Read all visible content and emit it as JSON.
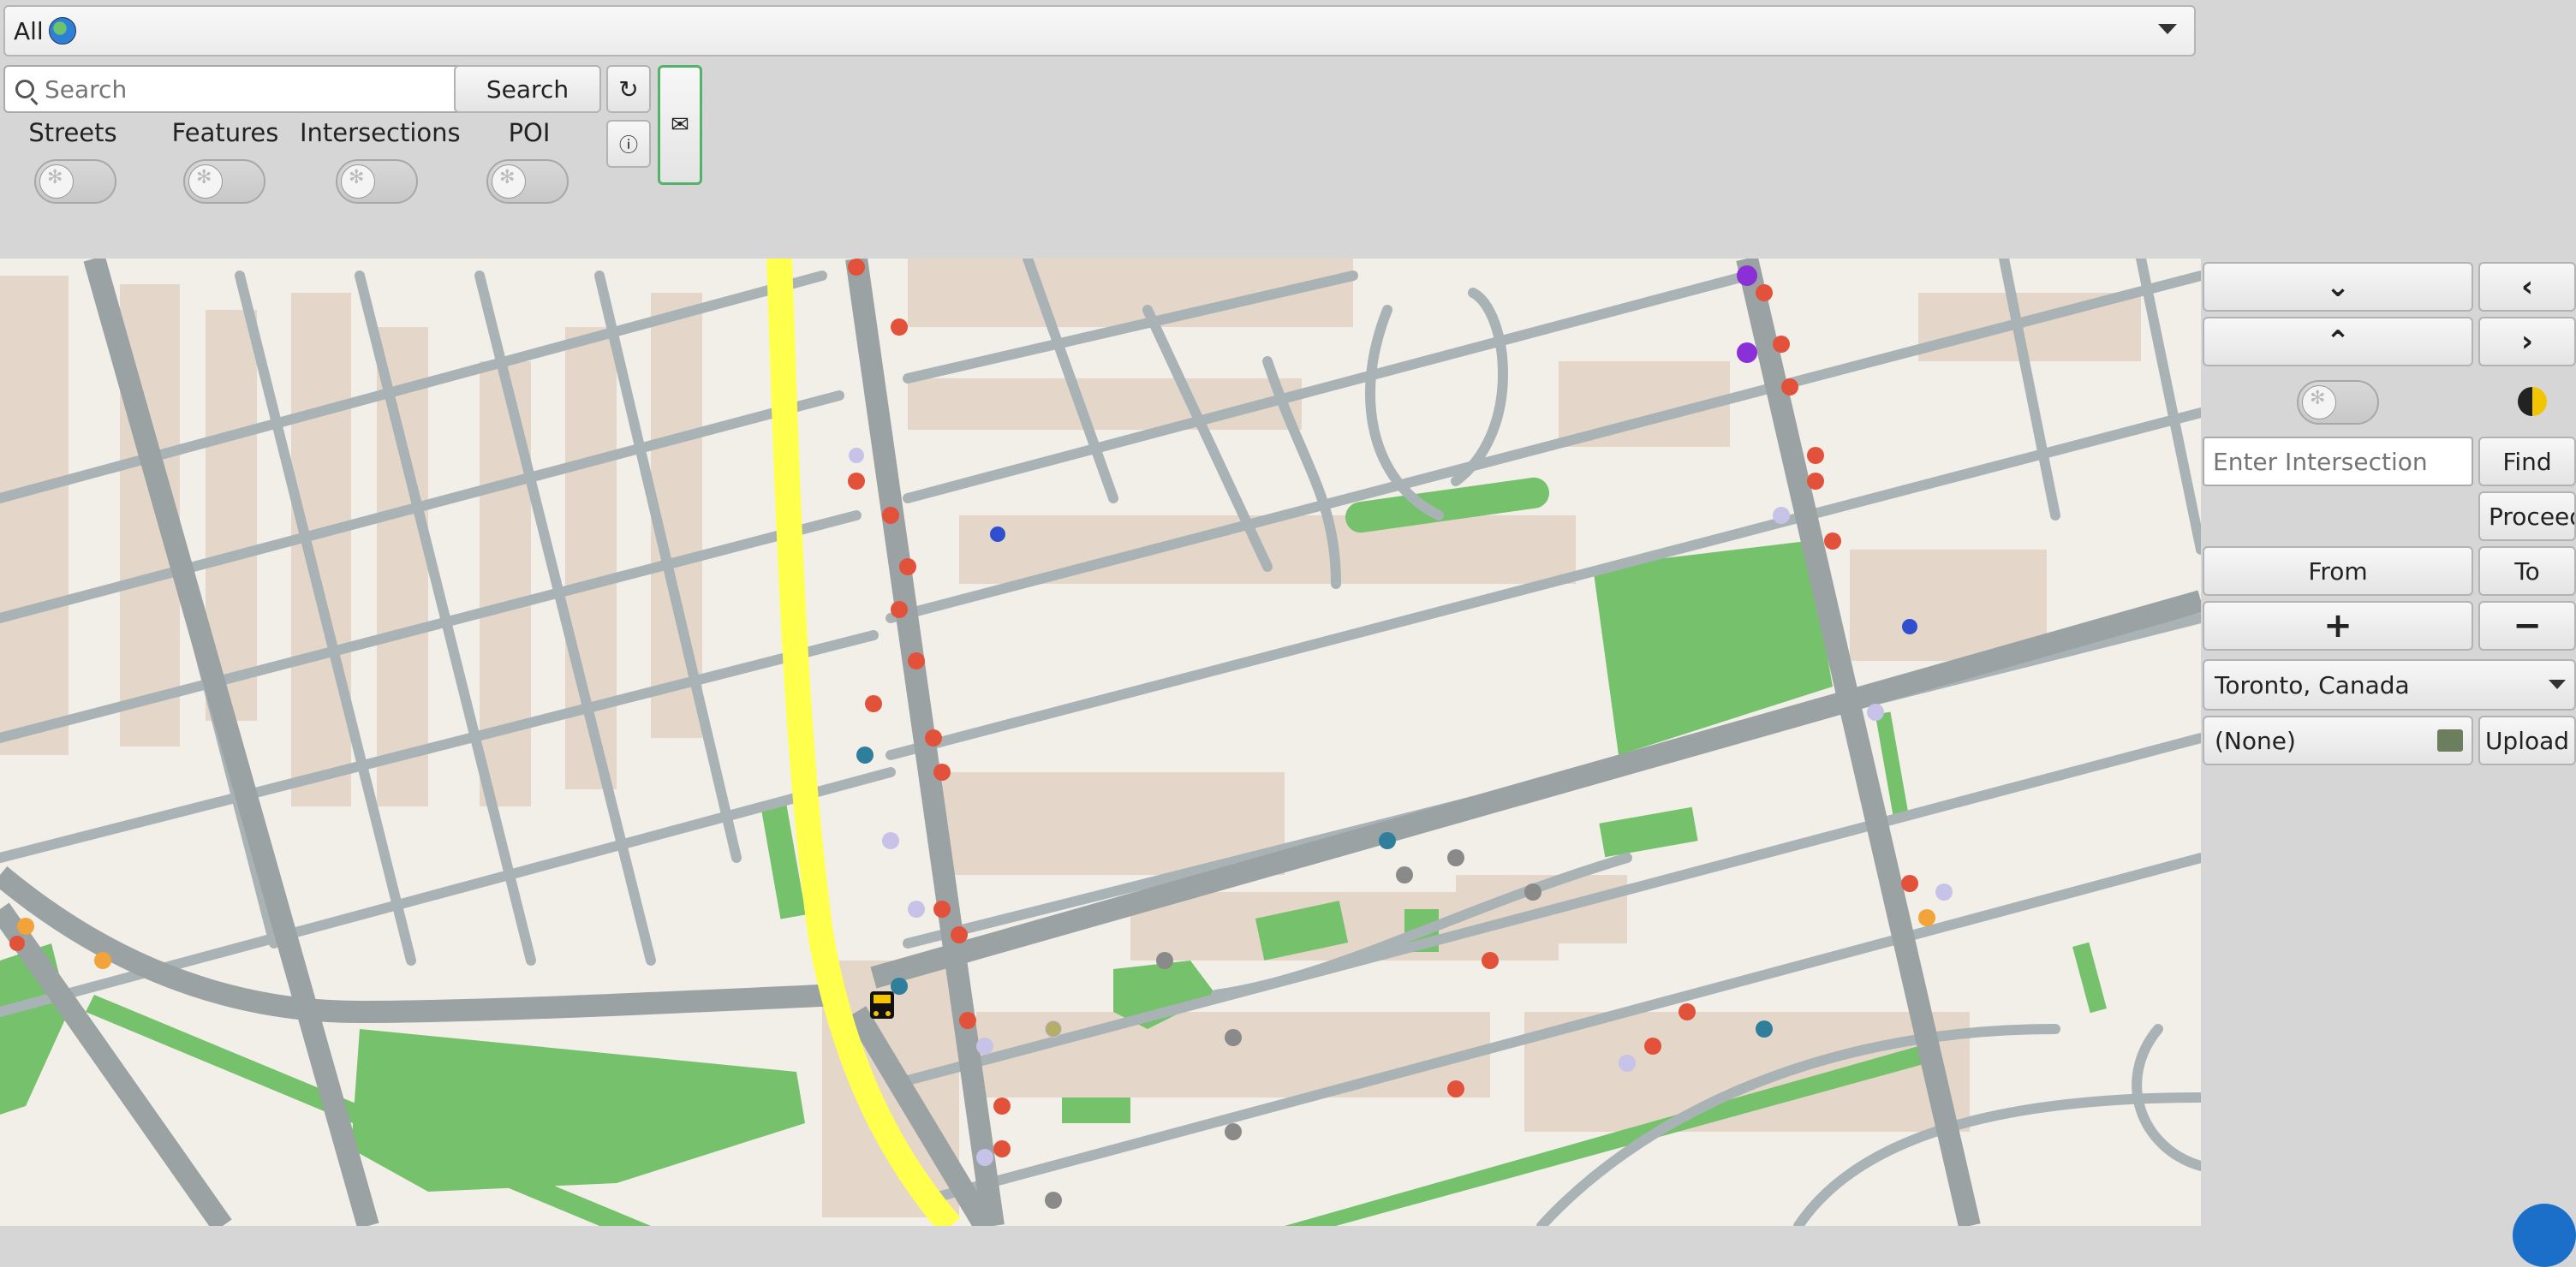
{
  "top": {
    "layer_select_value": "All",
    "search_placeholder": "Search",
    "search_button": "Search",
    "refresh_label": "↻",
    "info_label": "ⓘ",
    "mail_label": "✉"
  },
  "toggles": [
    {
      "label": "Streets",
      "on": false
    },
    {
      "label": "Features",
      "on": false
    },
    {
      "label": "Intersections",
      "on": false
    },
    {
      "label": "POI",
      "on": false
    }
  ],
  "right_panel": {
    "intersection_placeholder": "Enter Intersection",
    "find_label": "Find",
    "proceed_label": "Proceed",
    "from_label": "From",
    "to_label": "To",
    "zoom_in_label": "+",
    "zoom_out_label": "−",
    "city_value": "Toronto, Canada",
    "file_value": "(None)",
    "upload_label": "Upload"
  },
  "icons": {
    "combo_arrow": "chevron-down-icon",
    "globe": "globe-icon",
    "search": "search-icon",
    "clear": "backspace-clear-icon",
    "down": "chevron-down-icon",
    "up": "chevron-up-icon",
    "left": "chevron-left-icon",
    "right": "chevron-right-icon",
    "theme": "half-moon-icon",
    "folder": "folder-icon",
    "bus": "bus-icon"
  },
  "colors": {
    "map_bg": "#f2efe9",
    "road": "#a9b3b5",
    "major_road": "#9aa2a4",
    "highway": "#ffff4d",
    "park": "#76c16b",
    "building": "#e4d6c9",
    "panel_bg": "#d6d6d6"
  }
}
